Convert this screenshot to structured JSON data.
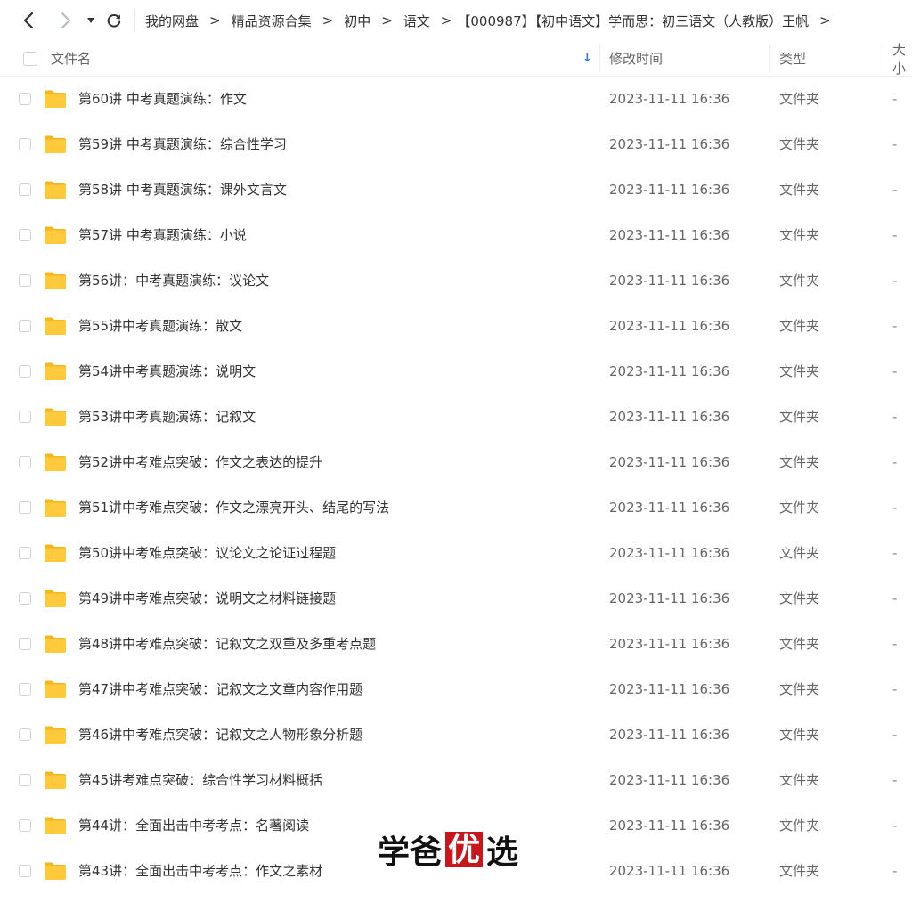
{
  "breadcrumb": [
    "我的网盘",
    "精品资源合集",
    "初中",
    "语文",
    "【000987】【初中语文】学而思：初三语文（人教版）王帆"
  ],
  "breadcrumb_separator": ">",
  "columns": {
    "name": "文件名",
    "modified": "修改时间",
    "type": "类型",
    "size": "大小"
  },
  "sort_indicator": "↓",
  "files": [
    {
      "name": "第60讲 中考真题演练：作文",
      "modified": "2023-11-11 16:36",
      "type": "文件夹",
      "size": "-"
    },
    {
      "name": "第59讲 中考真题演练：综合性学习",
      "modified": "2023-11-11 16:36",
      "type": "文件夹",
      "size": "-"
    },
    {
      "name": "第58讲 中考真题演练：课外文言文",
      "modified": "2023-11-11 16:36",
      "type": "文件夹",
      "size": "-"
    },
    {
      "name": "第57讲 中考真题演练：小说",
      "modified": "2023-11-11 16:36",
      "type": "文件夹",
      "size": "-"
    },
    {
      "name": "第56讲：中考真题演练：议论文",
      "modified": "2023-11-11 16:36",
      "type": "文件夹",
      "size": "-"
    },
    {
      "name": "第55讲中考真题演练：散文",
      "modified": "2023-11-11 16:36",
      "type": "文件夹",
      "size": "-"
    },
    {
      "name": "第54讲中考真题演练：说明文",
      "modified": "2023-11-11 16:36",
      "type": "文件夹",
      "size": "-"
    },
    {
      "name": "第53讲中考真题演练：记叙文",
      "modified": "2023-11-11 16:36",
      "type": "文件夹",
      "size": "-"
    },
    {
      "name": "第52讲中考难点突破：作文之表达的提升",
      "modified": "2023-11-11 16:36",
      "type": "文件夹",
      "size": "-"
    },
    {
      "name": "第51讲中考难点突破：作文之漂亮开头、结尾的写法",
      "modified": "2023-11-11 16:36",
      "type": "文件夹",
      "size": "-"
    },
    {
      "name": "第50讲中考难点突破：议论文之论证过程题",
      "modified": "2023-11-11 16:36",
      "type": "文件夹",
      "size": "-"
    },
    {
      "name": "第49讲中考难点突破：说明文之材料链接题",
      "modified": "2023-11-11 16:36",
      "type": "文件夹",
      "size": "-"
    },
    {
      "name": "第48讲中考难点突破：记叙文之双重及多重考点题",
      "modified": "2023-11-11 16:36",
      "type": "文件夹",
      "size": "-"
    },
    {
      "name": "第47讲中考难点突破：记叙文之文章内容作用题",
      "modified": "2023-11-11 16:36",
      "type": "文件夹",
      "size": "-"
    },
    {
      "name": "第46讲中考难点突破：记叙文之人物形象分析题",
      "modified": "2023-11-11 16:36",
      "type": "文件夹",
      "size": "-"
    },
    {
      "name": "第45讲考难点突破：综合性学习材料概括",
      "modified": "2023-11-11 16:36",
      "type": "文件夹",
      "size": "-"
    },
    {
      "name": "第44讲：全面出击中考考点：名著阅读",
      "modified": "2023-11-11 16:36",
      "type": "文件夹",
      "size": "-"
    },
    {
      "name": "第43讲：全面出击中考考点：作文之素材",
      "modified": "2023-11-11 16:36",
      "type": "文件夹",
      "size": "-"
    }
  ],
  "watermark": {
    "part1": "学爸",
    "boxed": "优",
    "part2": "选"
  },
  "colors": {
    "folder": "#FFC93C",
    "sort_arrow": "#2c7be5",
    "watermark_box": "#c8161d"
  },
  "icons": {
    "back": "chevron-left-icon",
    "forward": "chevron-right-icon",
    "dropdown": "caret-down-icon",
    "refresh": "refresh-icon",
    "folder": "folder-icon",
    "sort": "sort-down-icon"
  }
}
